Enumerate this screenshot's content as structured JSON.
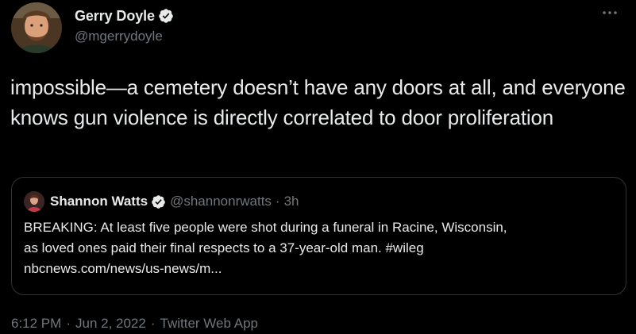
{
  "colors": {
    "background": "#000000",
    "text_primary": "#e7e9ea",
    "text_secondary": "#71767b",
    "border": "#2f3336",
    "verified": "#1d9bf0"
  },
  "tweet": {
    "author": {
      "display_name": "Gerry Doyle",
      "handle": "@mgerrydoyle",
      "verified_icon": "verified-badge-icon"
    },
    "more_icon": "more-dots-icon",
    "text": "impossible—a cemetery doesn’t have any doors at all, and everyone knows gun violence is directly correlated to door proliferation",
    "quoted": {
      "display_name": "Shannon Watts",
      "handle": "@shannonrwatts",
      "separator": "·",
      "time": "3h",
      "text_line1": "BREAKING: At least five people were shot during a funeral in Racine, Wisconsin,",
      "text_line2": "as loved ones paid their final respects to a 37-year-old man. #wileg",
      "text_line3": "nbcnews.com/news/us-news/m..."
    },
    "meta": {
      "time": "6:12 PM",
      "separator": "·",
      "date": "Jun 2, 2022",
      "app": "Twitter Web App"
    }
  }
}
